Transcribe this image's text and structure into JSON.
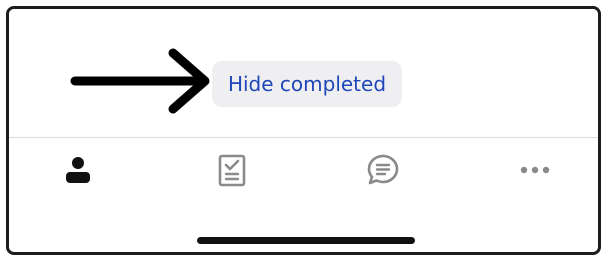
{
  "content": {
    "hide_completed_label": "Hide completed"
  },
  "tab_bar": {
    "tabs": [
      {
        "icon": "person-icon",
        "active": true
      },
      {
        "icon": "clipboard-check-icon",
        "active": false
      },
      {
        "icon": "chat-bubble-icon",
        "active": false
      },
      {
        "icon": "more-icon",
        "active": false
      }
    ]
  },
  "colors": {
    "accent": "#1f47b8",
    "button_bg": "#efeff2",
    "icon_active": "#111111",
    "icon_inactive": "#8a8a8a"
  }
}
